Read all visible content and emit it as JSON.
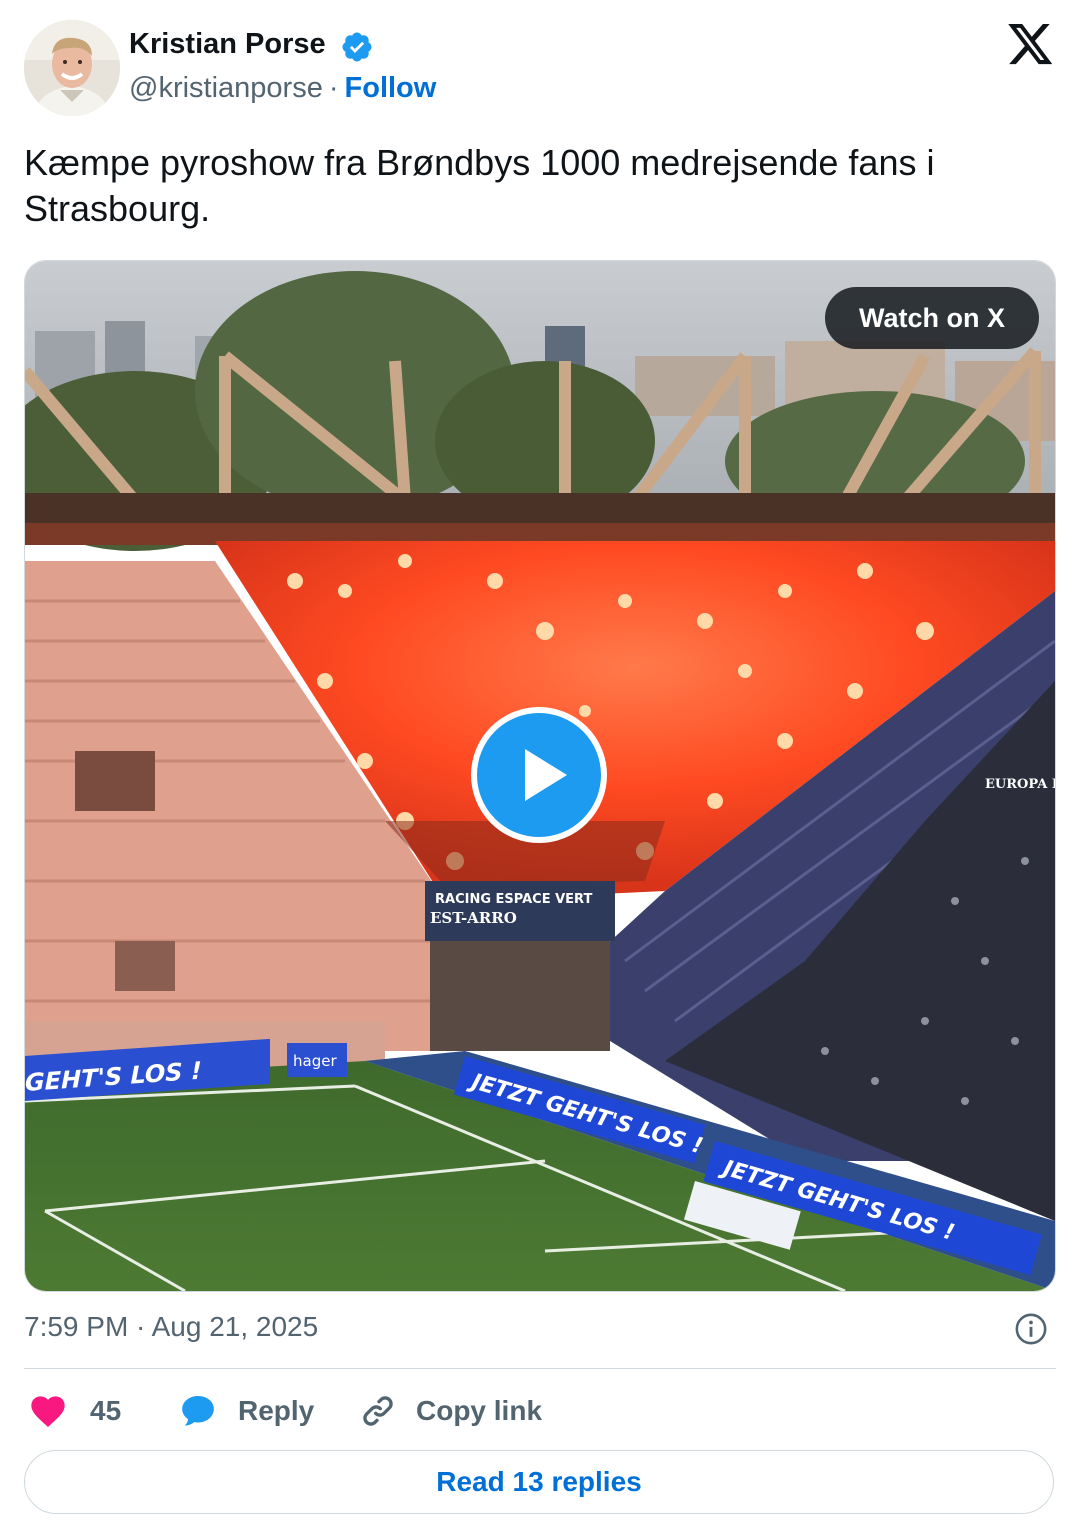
{
  "author": {
    "name": "Kristian Porse",
    "handle": "@kristianporse",
    "separator": "·",
    "follow_label": "Follow",
    "verified": true,
    "avatar_icon": "avatar-photo"
  },
  "brand": {
    "logo_icon": "x-logo-icon"
  },
  "tweet": {
    "text": "Kæmpe pyroshow fra Brøndbys 1000 medrejsende fans i Strasbourg."
  },
  "media": {
    "type": "video",
    "watch_label": "Watch on X",
    "play_icon": "play-icon",
    "banners": {
      "left_ad": "GEHT'S LOS !",
      "main_ad_1": "JETZT GEHT'S LOS !",
      "main_ad_2": "JETZT GEHT'S LOS !",
      "sponsor": "hager",
      "tunnel_sign_1": "RACING ESPACE VERT",
      "tunnel_sign_2": "EST-ARRO",
      "corner_sign": "EUROPA PA"
    }
  },
  "meta": {
    "timestamp": "7:59 PM · Aug 21, 2025",
    "info_icon": "info-icon"
  },
  "actions": {
    "like_count": "45",
    "reply_label": "Reply",
    "copy_label": "Copy link"
  },
  "footer": {
    "read_replies_label": "Read 13 replies"
  },
  "colors": {
    "link": "#006fd6",
    "verified": "#1d9bf0",
    "like": "#f91880",
    "reply": "#1d9bf0",
    "muted": "#536471",
    "border": "#cfd9de"
  }
}
